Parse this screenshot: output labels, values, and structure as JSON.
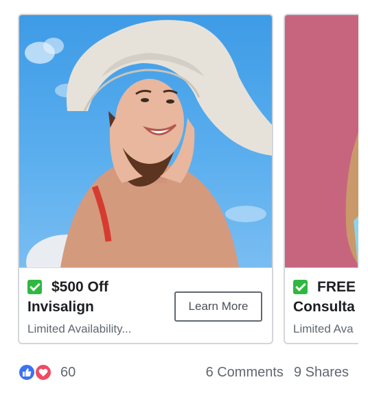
{
  "carousel": {
    "cards": [
      {
        "headline_line1": "$500 Off",
        "headline_line2": "Invisalign",
        "description": "Limited Availability...",
        "cta_label": "Learn More",
        "check_icon": "green-check-emoji-icon"
      },
      {
        "headline_line1": "FREE",
        "headline_line2": "Consulta",
        "description": "Limited Ava",
        "check_icon": "green-check-emoji-icon"
      }
    ]
  },
  "footer": {
    "reactions": {
      "icons": [
        "like-icon",
        "love-icon"
      ],
      "count": "60"
    },
    "comments_label": "6 Comments",
    "shares_label": "9 Shares"
  },
  "colors": {
    "like": "#3b72f2",
    "love": "#ef4b64",
    "check": "#2fb83f",
    "secondary_text": "#606770",
    "card_border": "#d3d5da"
  }
}
